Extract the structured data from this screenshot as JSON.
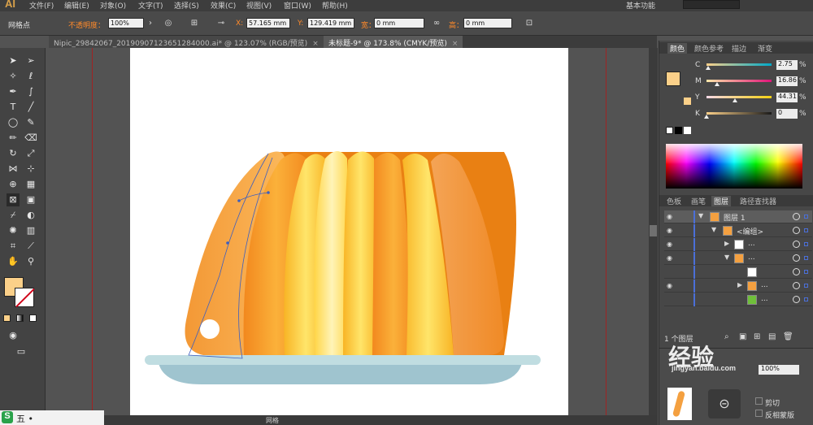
{
  "app": {
    "logo": "AI",
    "menu": [
      "文件(F)",
      "编辑(E)",
      "对象(O)",
      "文字(T)",
      "选择(S)",
      "效果(C)",
      "视图(V)",
      "窗口(W)",
      "帮助(H)"
    ],
    "workspace": "基本功能"
  },
  "control": {
    "selection_label": "网格点",
    "opacity_label": "不透明度：",
    "opacity_value": "100%",
    "x_label": "X:",
    "x_value": "57.165 mm",
    "y_label": "Y:",
    "y_value": "129.419 mm",
    "w_label": "宽：",
    "w_value": "0 mm",
    "h_label": "高：",
    "h_value": "0 mm"
  },
  "tabs": [
    {
      "label": "Nipic_29842067_20190907123651284000.ai* @ 123.07% (RGB/预览)",
      "active": false
    },
    {
      "label": "未标题-9* @ 173.8% (CMYK/预览)",
      "active": true
    }
  ],
  "tools": [
    "selection-tool",
    "direct-selection-tool",
    "magic-wand-tool",
    "lasso-tool",
    "pen-tool",
    "curvature-tool",
    "type-tool",
    "line-tool",
    "ellipse-tool",
    "paintbrush-tool",
    "pencil-tool",
    "eraser-tool",
    "rotate-tool",
    "scale-tool",
    "width-tool",
    "free-transform-tool",
    "shape-builder-tool",
    "perspective-tool",
    "mesh-tool",
    "gradient-tool",
    "eyedropper-tool",
    "blend-tool",
    "symbol-sprayer-tool",
    "graph-tool",
    "artboard-tool",
    "slice-tool",
    "hand-tool",
    "zoom-tool"
  ],
  "fill_color": "#fbd089",
  "status": {
    "zoom": "1",
    "mode": "网格"
  },
  "color_panel": {
    "tabs": [
      "颜色",
      "颜色参考",
      "描边",
      "渐变"
    ],
    "channels": [
      {
        "label": "C",
        "value": "2.75",
        "pct": "%",
        "level": 0.0275
      },
      {
        "label": "M",
        "value": "16.86",
        "pct": "%",
        "level": 0.1686
      },
      {
        "label": "Y",
        "value": "44.31",
        "pct": "%",
        "level": 0.4431
      },
      {
        "label": "K",
        "value": "0",
        "pct": "%",
        "level": 0
      }
    ]
  },
  "layers_panel": {
    "tabs": [
      "色板",
      "画笔",
      "图层",
      "路径查找器"
    ],
    "rows": [
      {
        "name": "图层 1",
        "indent": 0,
        "eye": true,
        "active": true
      },
      {
        "name": "<编组>",
        "indent": 1,
        "eye": true,
        "active": false
      },
      {
        "name": "...",
        "indent": 2,
        "eye": true,
        "active": false
      },
      {
        "name": "...",
        "indent": 2,
        "eye": true,
        "active": false
      },
      {
        "name": "",
        "indent": 3,
        "eye": false,
        "active": false
      },
      {
        "name": "...",
        "indent": 3,
        "eye": true,
        "active": false
      },
      {
        "name": "...",
        "indent": 3,
        "eye": false,
        "active": false
      }
    ],
    "footer": "1 个图层"
  },
  "transparency": {
    "opacity": "100%",
    "clip": "剪切",
    "invert": "反相蒙版"
  },
  "taskbar": {
    "ime": "S",
    "text": "五 •"
  },
  "watermark": {
    "text": "经验",
    "url": "jingyan.baidu.com"
  }
}
